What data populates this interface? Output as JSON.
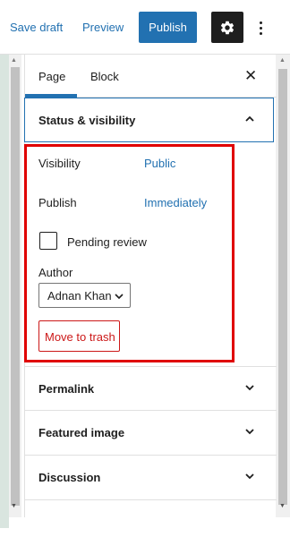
{
  "toolbar": {
    "save_draft_label": "Save draft",
    "preview_label": "Preview",
    "publish_label": "Publish",
    "settings_icon": "gear-icon",
    "more_icon": "vertical-ellipsis-icon"
  },
  "sidebar": {
    "tabs": [
      {
        "label": "Page",
        "active": true
      },
      {
        "label": "Block",
        "active": false
      }
    ],
    "close_icon": "close-icon",
    "status_panel": {
      "title": "Status & visibility",
      "expanded": true,
      "visibility_label": "Visibility",
      "visibility_value": "Public",
      "publish_label": "Publish",
      "publish_value": "Immediately",
      "pending_review_label": "Pending review",
      "pending_review_checked": false,
      "author_label": "Author",
      "author_value": "Adnan Khan",
      "trash_label": "Move to trash"
    },
    "panels": [
      {
        "title": "Permalink"
      },
      {
        "title": "Featured image"
      },
      {
        "title": "Discussion"
      }
    ]
  },
  "colors": {
    "accent": "#2271b1",
    "highlight": "#e00000",
    "danger": "#cc1818",
    "dark": "#1e1e1e"
  }
}
